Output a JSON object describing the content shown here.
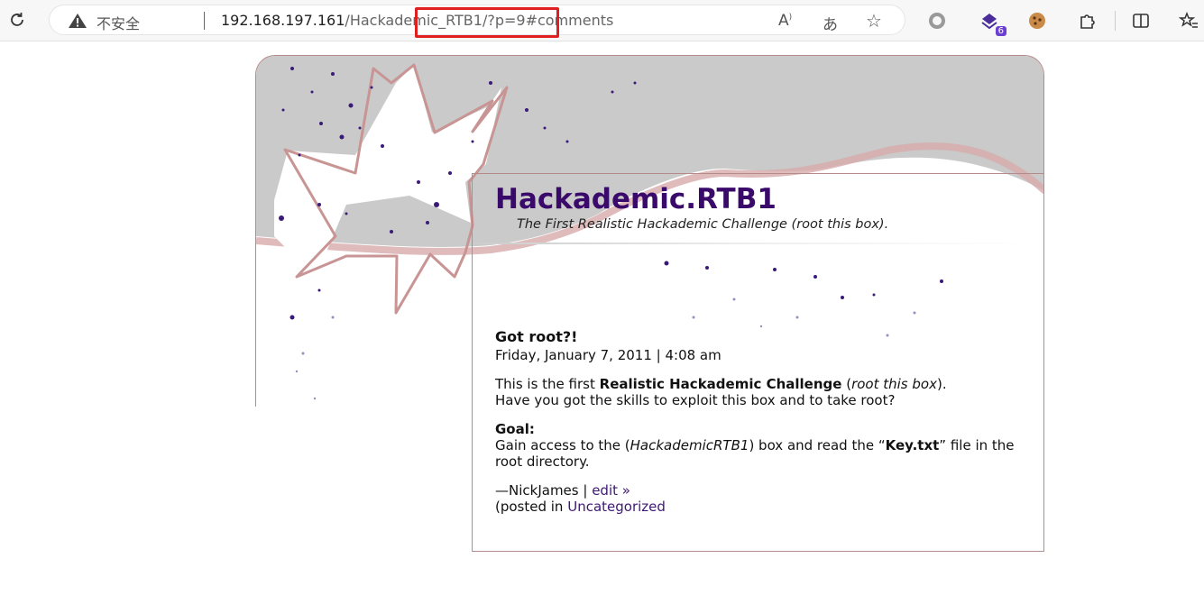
{
  "browser": {
    "security_label": "不安全",
    "url_host": "192.168.197.161",
    "url_path": "/Hackademic_RTB1/?p=9#comments",
    "extension_badge": "6",
    "icons": [
      "reload-icon",
      "warning-icon",
      "read-aloud-icon",
      "translate-icon",
      "favorite-star-icon",
      "circle-extension-icon",
      "extension-6-icon",
      "cookie-icon",
      "puzzle-icon",
      "split-screen-icon",
      "favorites-icon"
    ]
  },
  "blog": {
    "title": "Hackademic.RTB1",
    "description": "The First Realistic Hackademic Challenge (root this box)."
  },
  "post": {
    "title": "Got root?!",
    "date": "Friday, January 7, 2011 | 4:08 am",
    "p1_pre": "This is the first ",
    "p1_bold": "Realistic Hackademic Challenge",
    "p1_mid": " (",
    "p1_italic": "root this box",
    "p1_end": ").",
    "p1_line2": "Have you got the skills to exploit this box and to take root?",
    "goal_label": "Goal:",
    "goal_pre": "Gain access to the (",
    "goal_italic": "HackademicRTB1",
    "goal_mid": ") box and read the “",
    "goal_bold": "Key.txt",
    "goal_end": "” file in the root directory.",
    "author": "—NickJames | ",
    "edit_link": "edit »",
    "posted_in": "(posted in ",
    "category_link": "Uncategorized"
  }
}
